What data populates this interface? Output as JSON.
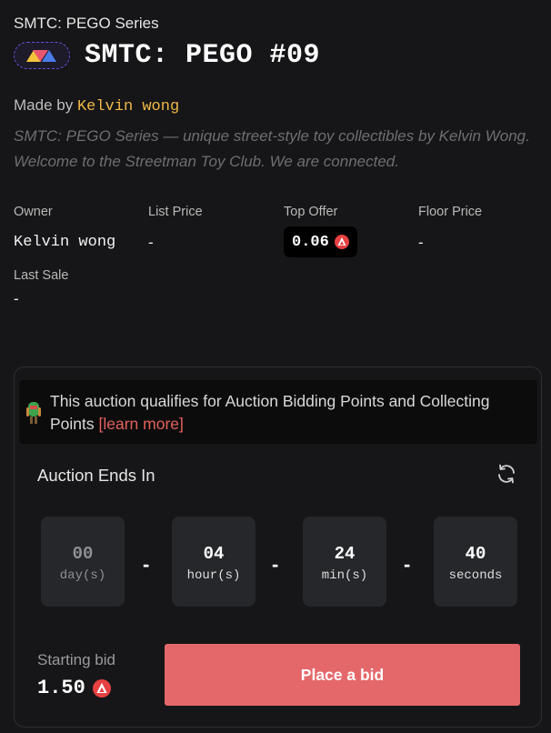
{
  "series_name": "SMTC: PEGO Series",
  "title": "SMTC: PEGO #09",
  "made_by_label": "Made by",
  "creator": "Kelvin wong",
  "description": "SMTC: PEGO Series — unique street-style toy collectibles by Kelvin Wong. Welcome to the Streetman Toy Club. We are connected.",
  "stats": {
    "owner_label": "Owner",
    "owner_value": "Kelvin wong",
    "list_price_label": "List Price",
    "list_price_value": "-",
    "top_offer_label": "Top Offer",
    "top_offer_value": "0.06",
    "floor_price_label": "Floor Price",
    "floor_price_value": "-",
    "last_sale_label": "Last Sale",
    "last_sale_value": "-"
  },
  "notice": {
    "text": "This auction qualifies for Auction Bidding Points and Collecting Points",
    "link": "[learn more]"
  },
  "auction": {
    "ends_label": "Auction Ends In",
    "countdown": [
      {
        "value": "00",
        "unit": "day(s)"
      },
      {
        "value": "04",
        "unit": "hour(s)"
      },
      {
        "value": "24",
        "unit": "min(s)"
      },
      {
        "value": "40",
        "unit": "seconds"
      }
    ],
    "separator": "-",
    "starting_bid_label": "Starting bid",
    "starting_bid_value": "1.50",
    "place_bid_label": "Place a bid"
  },
  "colors": {
    "background": "#161618",
    "accent_creator": "#f0b847",
    "bid_button": "#e4686a",
    "avax_red": "#e84142",
    "link": "#e4625b"
  },
  "icons": {
    "collection_badge": "triangle-badge-icon",
    "currency": "avax-icon",
    "refresh": "refresh-icon",
    "notice": "toy-icon"
  }
}
